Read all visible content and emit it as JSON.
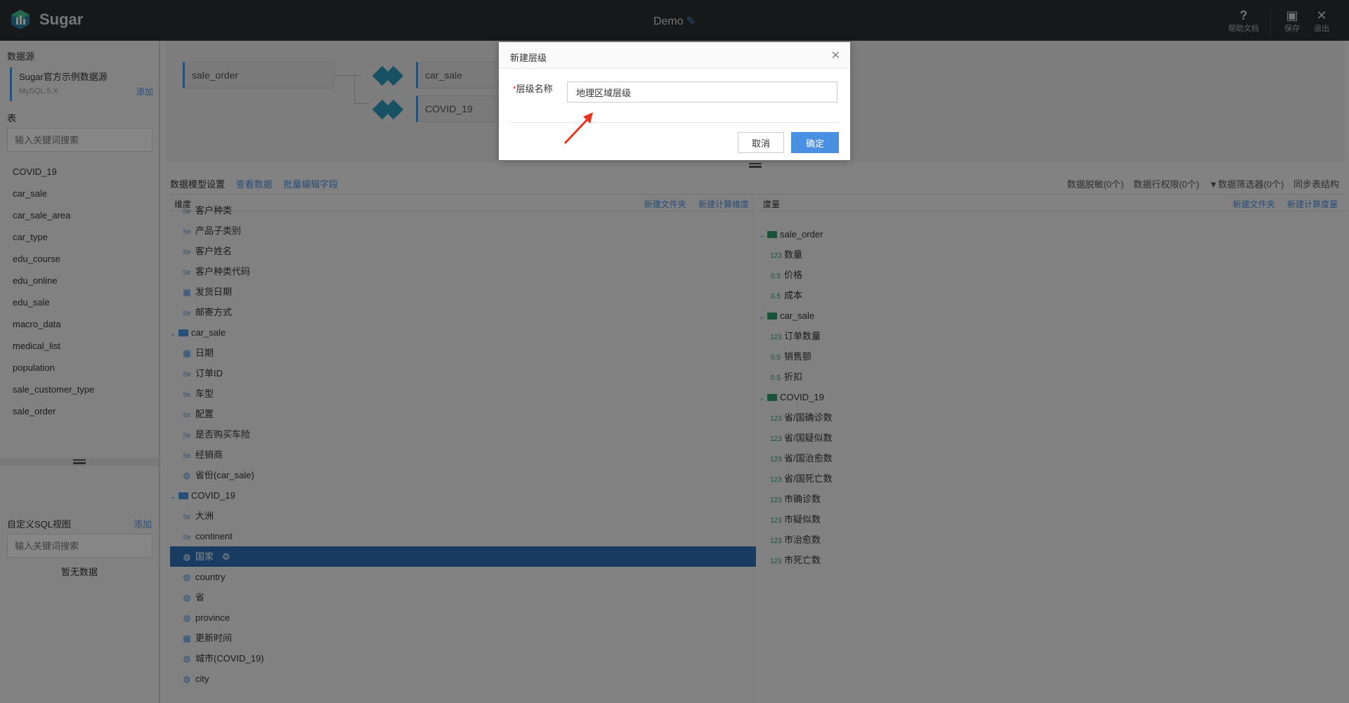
{
  "header": {
    "logo_text": "Sugar",
    "title": "Demo",
    "help_label": "帮助文档",
    "save_label": "保存",
    "exit_label": "退出"
  },
  "sidebar": {
    "datasource_title": "数据源",
    "datasource_name": "Sugar官方示例数据源",
    "datasource_type": "MySQL 5.X",
    "add_label": "添加",
    "tables_title": "表",
    "search_placeholder": "输入关键词搜索",
    "tables": [
      "COVID_19",
      "car_sale",
      "car_sale_area",
      "car_type",
      "edu_course",
      "edu_online",
      "edu_sale",
      "macro_data",
      "medical_list",
      "population",
      "sale_customer_type",
      "sale_order"
    ],
    "sql_title": "自定义SQL视图",
    "sql_add_label": "添加",
    "sql_search_placeholder": "输入关键词搜索",
    "no_data": "暂无数据"
  },
  "diagram": {
    "main_table": "sale_order",
    "joined": [
      "car_sale",
      "COVID_19"
    ]
  },
  "toolbar": {
    "tabs": [
      "数据模型设置",
      "查看数据",
      "批量编辑字段"
    ],
    "right": [
      "数据脱敏(0个)",
      "数据行权限(0个)",
      "数据筛选器(0个)",
      "同步表结构"
    ]
  },
  "dimension_panel": {
    "title": "维度",
    "actions": [
      "新建文件夹",
      "新建计算维度"
    ],
    "rows": [
      {
        "icon": "Str",
        "label": "客户种类"
      },
      {
        "icon": "Str",
        "label": "产品子类别"
      },
      {
        "icon": "Str",
        "label": "客户姓名"
      },
      {
        "icon": "Str",
        "label": "客户种类代码"
      },
      {
        "icon": "date",
        "label": "发货日期"
      },
      {
        "icon": "Str",
        "label": "邮寄方式"
      },
      {
        "icon": "folder",
        "label": "car_sale"
      },
      {
        "icon": "date",
        "label": "日期"
      },
      {
        "icon": "Str",
        "label": "订单ID"
      },
      {
        "icon": "Str",
        "label": "车型"
      },
      {
        "icon": "Str",
        "label": "配置"
      },
      {
        "icon": "Str",
        "label": "是否购买车险"
      },
      {
        "icon": "Str",
        "label": "经销商"
      },
      {
        "icon": "geo",
        "label": "省份(car_sale)"
      },
      {
        "icon": "folder",
        "label": "COVID_19"
      },
      {
        "icon": "Str",
        "label": "大洲"
      },
      {
        "icon": "Str",
        "label": "continent"
      },
      {
        "icon": "geo",
        "label": "国家",
        "selected": true
      },
      {
        "icon": "geo",
        "label": "country"
      },
      {
        "icon": "geo",
        "label": "省"
      },
      {
        "icon": "geo",
        "label": "province"
      },
      {
        "icon": "date",
        "label": "更新时间"
      },
      {
        "icon": "geo",
        "label": "城市(COVID_19)"
      },
      {
        "icon": "geo",
        "label": "city"
      }
    ]
  },
  "measure_panel": {
    "title": "度量",
    "actions": [
      "新建文件夹",
      "新建计算度量"
    ],
    "rows": [
      {
        "icon": "folder",
        "label": "sale_order"
      },
      {
        "icon": "123",
        "label": "数量"
      },
      {
        "icon": "0.5",
        "label": "价格"
      },
      {
        "icon": "0.5",
        "label": "成本"
      },
      {
        "icon": "folder",
        "label": "car_sale"
      },
      {
        "icon": "123",
        "label": "订单数量"
      },
      {
        "icon": "0.5",
        "label": "销售额"
      },
      {
        "icon": "0.5",
        "label": "折扣"
      },
      {
        "icon": "folder",
        "label": "COVID_19"
      },
      {
        "icon": "123",
        "label": "省/国确诊数"
      },
      {
        "icon": "123",
        "label": "省/国疑似数"
      },
      {
        "icon": "123",
        "label": "省/国治愈数"
      },
      {
        "icon": "123",
        "label": "省/国死亡数"
      },
      {
        "icon": "123",
        "label": "市确诊数"
      },
      {
        "icon": "123",
        "label": "市疑似数"
      },
      {
        "icon": "123",
        "label": "市治愈数"
      },
      {
        "icon": "123",
        "label": "市死亡数"
      }
    ]
  },
  "modal": {
    "title": "新建层级",
    "required_mark": "*",
    "label": "层级名称",
    "value": "地理区域层级",
    "cancel": "取消",
    "ok": "确定"
  }
}
